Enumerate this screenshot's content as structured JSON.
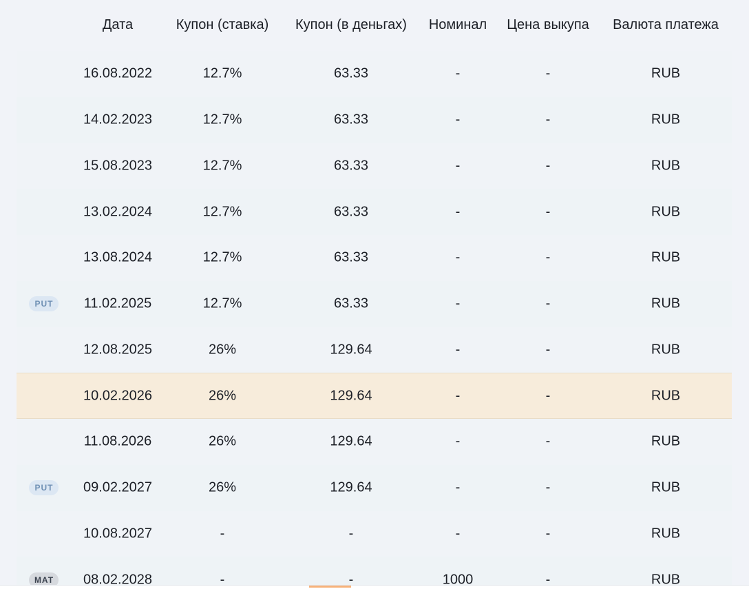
{
  "header": {
    "date": "Дата",
    "coupon_rate": "Купон (ставка)",
    "coupon_money": "Купон (в деньгах)",
    "nominal": "Номинал",
    "redemption_price": "Цена выкупа",
    "currency": "Валюта платежа"
  },
  "rows": [
    {
      "badge": "",
      "date": "16.08.2022",
      "rate": "12.7%",
      "money": "63.33",
      "nominal": "-",
      "price": "-",
      "currency": "RUB"
    },
    {
      "badge": "",
      "date": "14.02.2023",
      "rate": "12.7%",
      "money": "63.33",
      "nominal": "-",
      "price": "-",
      "currency": "RUB"
    },
    {
      "badge": "",
      "date": "15.08.2023",
      "rate": "12.7%",
      "money": "63.33",
      "nominal": "-",
      "price": "-",
      "currency": "RUB"
    },
    {
      "badge": "",
      "date": "13.02.2024",
      "rate": "12.7%",
      "money": "63.33",
      "nominal": "-",
      "price": "-",
      "currency": "RUB"
    },
    {
      "badge": "",
      "date": "13.08.2024",
      "rate": "12.7%",
      "money": "63.33",
      "nominal": "-",
      "price": "-",
      "currency": "RUB"
    },
    {
      "badge": "PUT",
      "date": "11.02.2025",
      "rate": "12.7%",
      "money": "63.33",
      "nominal": "-",
      "price": "-",
      "currency": "RUB"
    },
    {
      "badge": "",
      "date": "12.08.2025",
      "rate": "26%",
      "money": "129.64",
      "nominal": "-",
      "price": "-",
      "currency": "RUB"
    },
    {
      "badge": "",
      "date": "10.02.2026",
      "rate": "26%",
      "money": "129.64",
      "nominal": "-",
      "price": "-",
      "currency": "RUB",
      "current": true
    },
    {
      "badge": "",
      "date": "11.08.2026",
      "rate": "26%",
      "money": "129.64",
      "nominal": "-",
      "price": "-",
      "currency": "RUB"
    },
    {
      "badge": "PUT",
      "date": "09.02.2027",
      "rate": "26%",
      "money": "129.64",
      "nominal": "-",
      "price": "-",
      "currency": "RUB"
    },
    {
      "badge": "",
      "date": "10.08.2027",
      "rate": "-",
      "money": "-",
      "nominal": "-",
      "price": "-",
      "currency": "RUB"
    },
    {
      "badge": "MAT",
      "date": "08.02.2028",
      "rate": "-",
      "money": "-",
      "nominal": "1000",
      "price": "-",
      "currency": "RUB"
    }
  ],
  "colors": {
    "background": "#f1f3f8",
    "current_row": "#f7ecdb",
    "put_badge_bg": "#dce7f3",
    "put_badge_text": "#6f90b4",
    "mat_badge_bg": "#d6d9de",
    "scroll_thumb": "#f7b27a"
  }
}
